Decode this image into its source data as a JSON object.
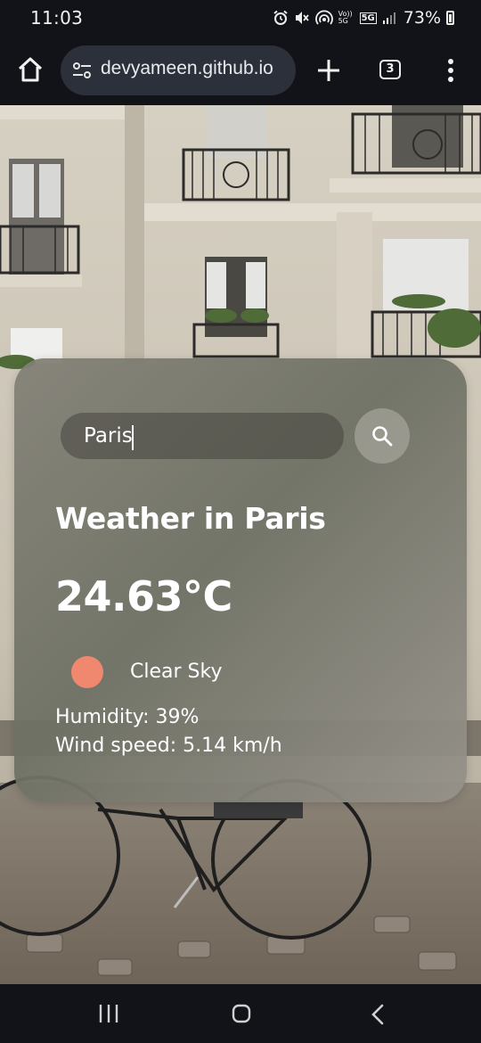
{
  "status_bar": {
    "time": "11:03",
    "network_volte": "Vo)) 5G",
    "network_5g": "5G",
    "battery": "73%"
  },
  "browser": {
    "url": "devyameen.github.io",
    "tab_count": "3",
    "icons": [
      "home-icon",
      "site-settings-icon",
      "plus-icon",
      "tabs-icon",
      "more-vert-icon"
    ]
  },
  "weather": {
    "search_value": "Paris",
    "title": "Weather in Paris",
    "temperature": "24.63°C",
    "description": "Clear Sky",
    "humidity": "Humidity: 39%",
    "wind": "Wind speed: 5.14 km/h",
    "icon_color": "#f08870"
  },
  "nav_bar": {
    "icons": [
      "recent-apps-icon",
      "home-icon",
      "back-icon"
    ]
  }
}
